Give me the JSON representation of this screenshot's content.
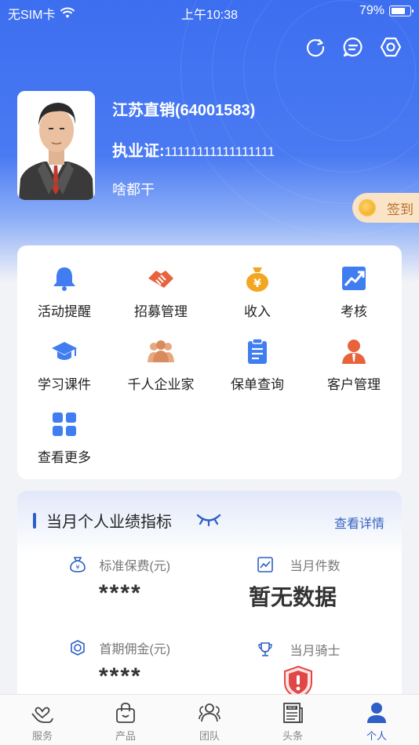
{
  "status_bar": {
    "carrier": "无SIM卡",
    "time": "上午10:38",
    "battery": "79%",
    "battery_level": 0.79
  },
  "header_icons": [
    "refresh-icon",
    "message-icon",
    "settings-icon"
  ],
  "profile": {
    "name": "江苏直销(64001583)",
    "license_label": "执业证:",
    "license_number": "11111111111111111",
    "motto": "啥都干"
  },
  "signin": {
    "label": "签到"
  },
  "menu": [
    {
      "label": "活动提醒",
      "icon": "bell-icon"
    },
    {
      "label": "招募管理",
      "icon": "handshake-icon"
    },
    {
      "label": "收入",
      "icon": "money-bag-icon"
    },
    {
      "label": "考核",
      "icon": "trend-chart-icon"
    },
    {
      "label": "学习课件",
      "icon": "graduation-cap-icon"
    },
    {
      "label": "千人企业家",
      "icon": "group-icon"
    },
    {
      "label": "保单查询",
      "icon": "clipboard-icon"
    },
    {
      "label": "客户管理",
      "icon": "customer-icon"
    },
    {
      "label": "查看更多",
      "icon": "grid-icon"
    }
  ],
  "performance": {
    "title": "当月个人业绩指标",
    "detail_link": "查看详情",
    "stats": [
      {
        "label": "标准保费(元)",
        "value": "****",
        "icon": "money-bag-outline-icon"
      },
      {
        "label": "当月件数",
        "value": "暂无数据",
        "icon": "chart-box-icon"
      },
      {
        "label": "首期佣金(元)",
        "value": "****",
        "icon": "coin-outline-icon"
      },
      {
        "label": "当月骑士",
        "value": "",
        "icon": "trophy-icon"
      }
    ]
  },
  "tabs": [
    {
      "label": "服务",
      "icon": "heart-hand-icon",
      "active": false
    },
    {
      "label": "产品",
      "icon": "shopping-bag-icon",
      "active": false
    },
    {
      "label": "团队",
      "icon": "team-icon",
      "active": false
    },
    {
      "label": "头条",
      "icon": "newspaper-icon",
      "active": false
    },
    {
      "label": "个人",
      "icon": "person-icon",
      "active": true
    }
  ],
  "colors": {
    "primary": "#3c6ef0",
    "accent": "#2e5ec6",
    "signin_bg": "#fbe3c6",
    "warning": "#e04848"
  }
}
